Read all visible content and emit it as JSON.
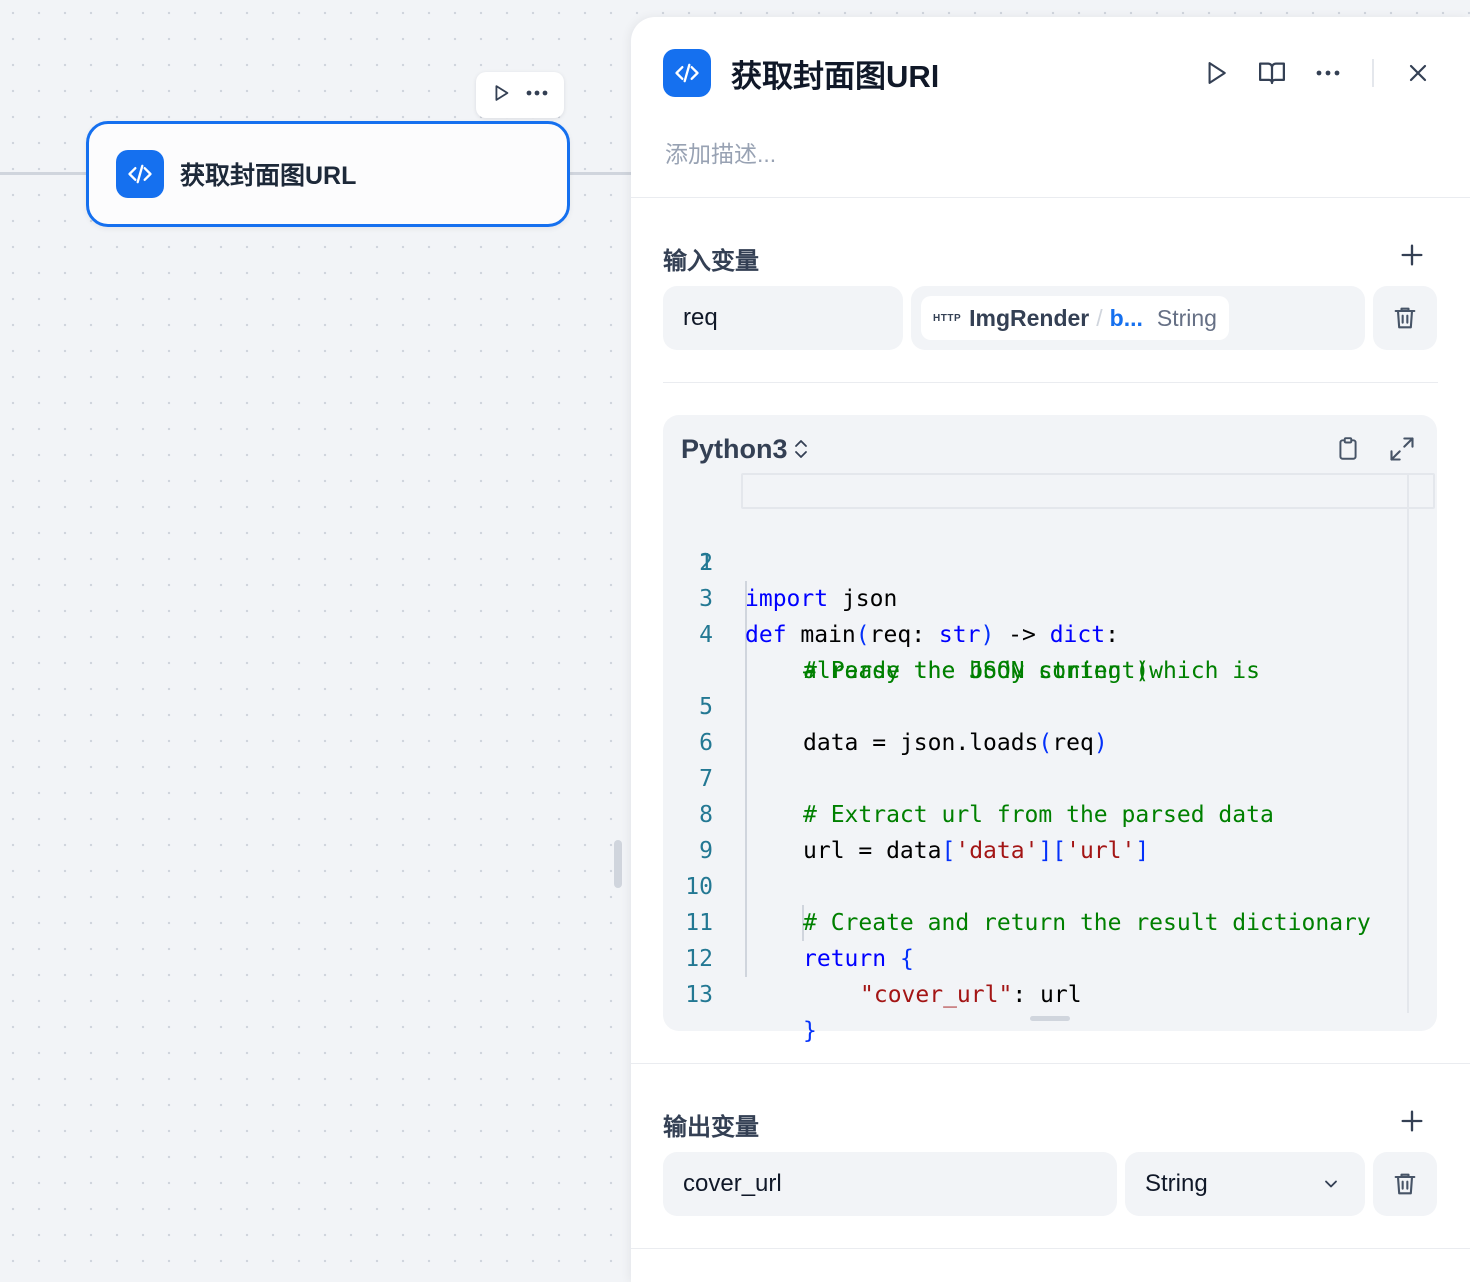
{
  "canvas": {
    "node": {
      "title": "获取封面图URL",
      "icon": "code-icon",
      "accent_color": "#1570ef"
    },
    "toolbar": {
      "run_icon": "play-icon",
      "more_icon": "more-horizontal-icon"
    }
  },
  "panel": {
    "title": "获取封面图URl",
    "description_placeholder": "添加描述...",
    "header_icons": [
      "play-icon",
      "book-open-icon",
      "more-horizontal-icon",
      "close-icon"
    ],
    "inputs": {
      "label": "输入变量",
      "items": [
        {
          "name": "req",
          "source_tag": "HTTP",
          "source_node": "ImgRender",
          "source_separator": "/",
          "source_var": "b...",
          "source_type": "String"
        }
      ]
    },
    "code": {
      "language": "Python3",
      "lines": [
        {
          "n": "1",
          "text": "import json"
        },
        {
          "n": "2",
          "text": ""
        },
        {
          "n": "3",
          "text": "def main(req: str) -> dict:"
        },
        {
          "n": "4",
          "text": "    # Parse the JSON string (which is already the body content)"
        },
        {
          "n": "5",
          "text": "    data = json.loads(req)"
        },
        {
          "n": "6",
          "text": ""
        },
        {
          "n": "7",
          "text": "    # Extract url from the parsed data"
        },
        {
          "n": "8",
          "text": "    url = data['data']['url']"
        },
        {
          "n": "9",
          "text": ""
        },
        {
          "n": "10",
          "text": "    # Create and return the result dictionary"
        },
        {
          "n": "11",
          "text": "    return {"
        },
        {
          "n": "12",
          "text": "        \"cover_url\": url"
        },
        {
          "n": "13",
          "text": "    }"
        }
      ],
      "tokens": {
        "l1_kw": "import",
        "l1_rest": " json",
        "l3_kw": "def",
        "l3_name": " main",
        "l3_p1": "(",
        "l3_arg": "req: ",
        "l3_type": "str",
        "l3_p2": ")",
        "l3_arrow": " -> ",
        "l3_ret": "dict",
        "l3_colon": ":",
        "l4_a": "# Parse the JSON string (which is",
        "l4_b": "already the body content)",
        "l5_a": "data = json.loads",
        "l5_p1": "(",
        "l5_arg": "req",
        "l5_p2": ")",
        "l7": "# Extract url from the parsed data",
        "l8_a": "url = data",
        "l8_b1": "[",
        "l8_s1": "'data'",
        "l8_b2": "][",
        "l8_s2": "'url'",
        "l8_b3": "]",
        "l10": "# Create and return the result dictionary",
        "l11_kw": "return",
        "l11_br": "{",
        "l12_s": "\"cover_url\"",
        "l12_rest": ": url",
        "l13_br": "}"
      }
    },
    "outputs": {
      "label": "输出变量",
      "items": [
        {
          "name": "cover_url",
          "type": "String"
        }
      ]
    }
  }
}
